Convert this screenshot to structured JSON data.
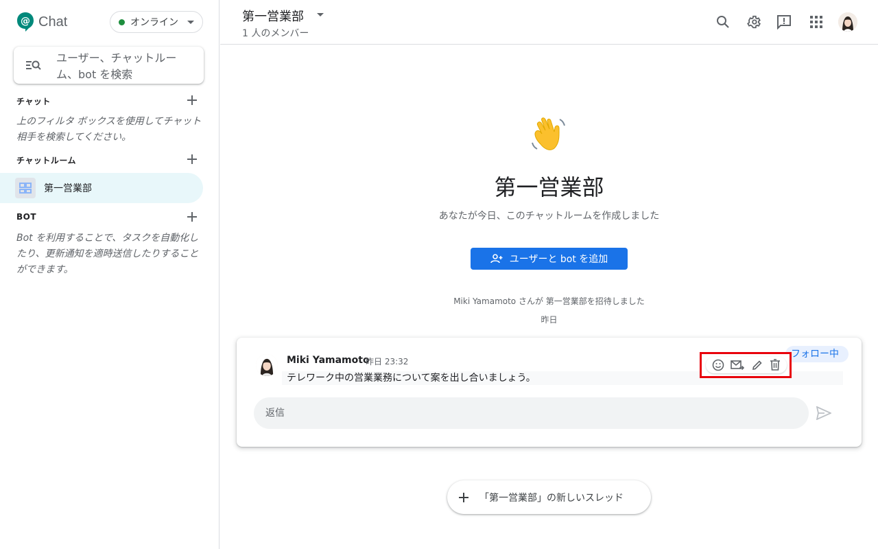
{
  "app": {
    "name": "Chat"
  },
  "status": {
    "label": "オンライン",
    "color": "#1e8e3e"
  },
  "search": {
    "placeholder": "ユーザー、チャットルーム、bot を検索"
  },
  "sidebar": {
    "chat": {
      "title": "チャット",
      "empty": "上のフィルタ ボックスを使用してチャット相手を検索してください。"
    },
    "rooms": {
      "title": "チャットルーム",
      "items": [
        {
          "label": "第一営業部"
        }
      ]
    },
    "bot": {
      "title": "BOT",
      "empty": "Bot を利用することで、タスクを自動化したり、更新通知を適時送信したりすることができます。"
    }
  },
  "header": {
    "title": "第一営業部",
    "members": "1 人のメンバー",
    "icons": [
      "search-icon",
      "gear-icon",
      "feedback-icon",
      "apps-grid-icon",
      "account-avatar"
    ]
  },
  "main": {
    "title": "第一営業部",
    "subtitle": "あなたが今日、このチャットルームを作成しました",
    "add_button": "ユーザーと bot を追加",
    "system_message": "Miki Yamamoto さんが 第一営業部を招待しました",
    "system_date": "昨日"
  },
  "thread": {
    "author": "Miki Yamamoto",
    "time": "昨日 23:32",
    "body": "テレワーク中の営業業務について案を出し合いましょう。",
    "follow_label": "フォロー中",
    "actions": [
      "emoji-icon",
      "forward-to-inbox-icon",
      "edit-icon",
      "delete-icon"
    ],
    "reply_placeholder": "返信"
  },
  "new_thread": {
    "label": "「第一営業部」の新しいスレッド"
  },
  "colors": {
    "accent": "#1a73e8",
    "highlight_box": "#e8000b",
    "selected_room_bg": "#e8f7fa"
  }
}
